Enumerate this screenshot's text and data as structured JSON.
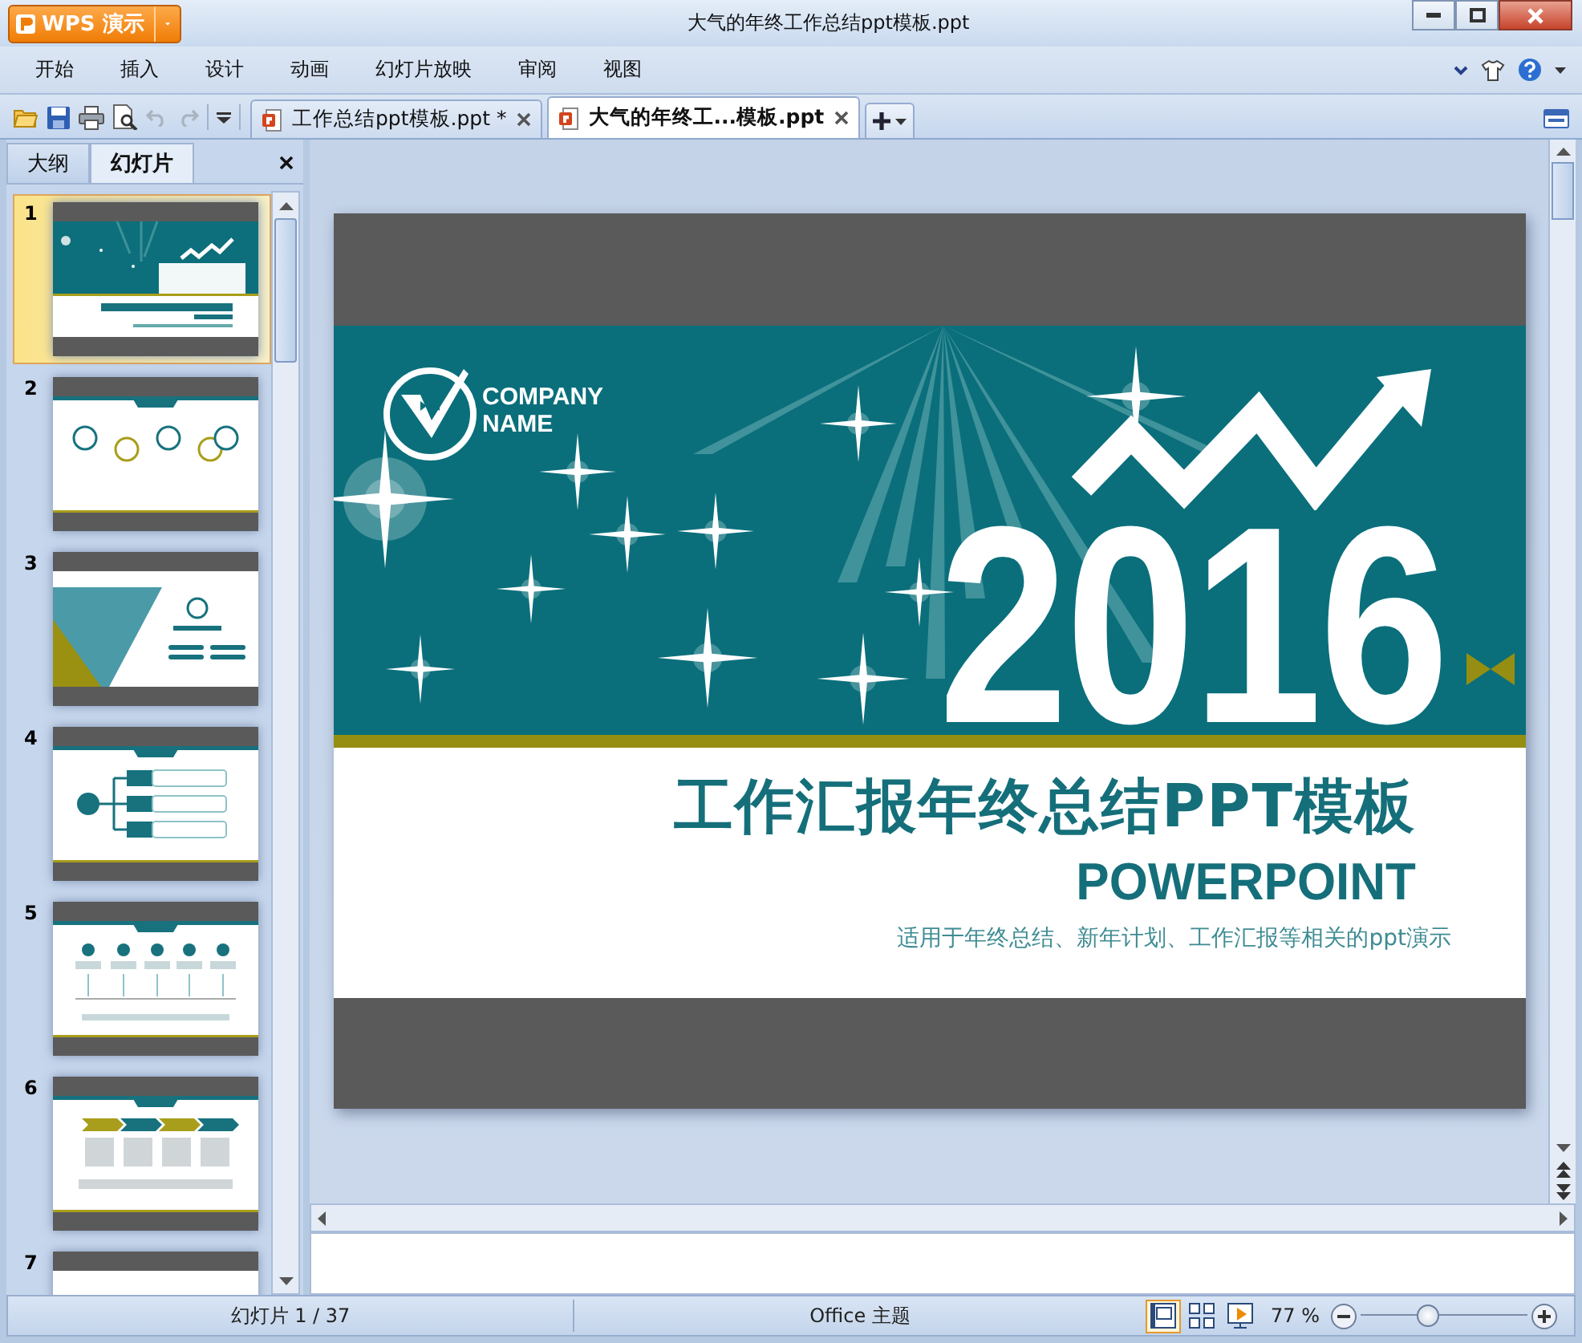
{
  "window": {
    "app_button": "WPS 演示",
    "title": "大气的年终工作总结ppt模板.ppt"
  },
  "menu": [
    {
      "label": "开始"
    },
    {
      "label": "插入"
    },
    {
      "label": "设计"
    },
    {
      "label": "动画"
    },
    {
      "label": "幻灯片放映"
    },
    {
      "label": "审阅"
    },
    {
      "label": "视图"
    }
  ],
  "doc_tabs": [
    {
      "label": "工作总结ppt模板.ppt *",
      "selected": false
    },
    {
      "label": "大气的年终工...模板.ppt",
      "selected": true
    }
  ],
  "panel_tabs": [
    {
      "label": "大纲",
      "selected": false
    },
    {
      "label": "幻灯片",
      "selected": true
    }
  ],
  "thumbnails": [
    {
      "number": "1",
      "kind": "title",
      "selected": true
    },
    {
      "number": "2",
      "kind": "agenda",
      "selected": false
    },
    {
      "number": "3",
      "kind": "section",
      "selected": false
    },
    {
      "number": "4",
      "kind": "branches",
      "selected": false
    },
    {
      "number": "5",
      "kind": "timeline",
      "selected": false
    },
    {
      "number": "6",
      "kind": "steps",
      "selected": false
    },
    {
      "number": "7",
      "kind": "blank",
      "selected": false
    }
  ],
  "slide": {
    "company": [
      "COMPANY",
      "NAME"
    ],
    "year": "2016",
    "title": "工作汇报年终总结PPT模板",
    "subtitle": "POWERPOINT",
    "tagline": "适用于年终总结、新年计划、工作汇报等相关的ppt演示"
  },
  "status_bar": {
    "slide_counter": "幻灯片 1 / 37",
    "theme": "Office 主题",
    "views": [
      {
        "kind": "normal",
        "selected": true
      },
      {
        "kind": "sorter",
        "selected": false
      },
      {
        "kind": "show",
        "selected": false
      }
    ],
    "zoom": "77 %",
    "zoom_slider": {
      "level": 0.4
    }
  }
}
